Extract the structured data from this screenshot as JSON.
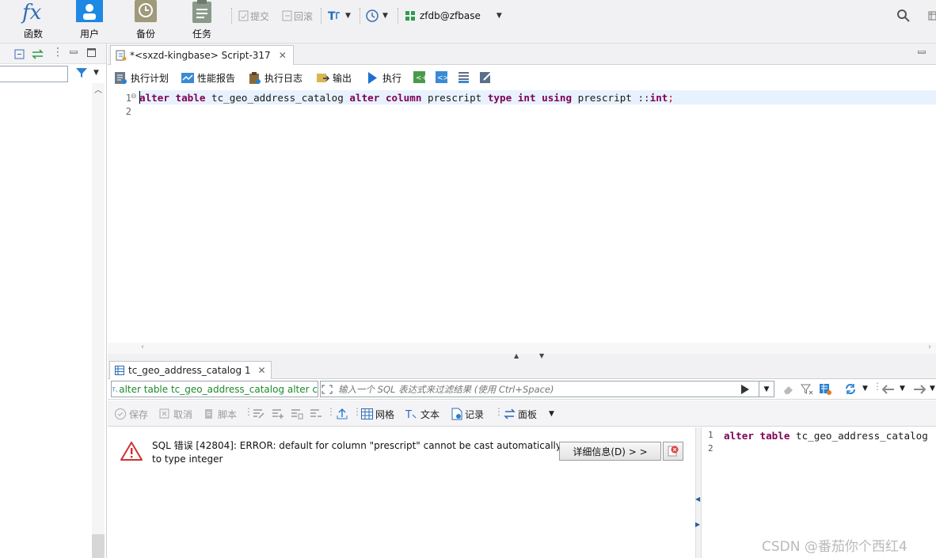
{
  "toolbar": {
    "functions_label": "函数",
    "users_label": "用户",
    "backup_label": "备份",
    "tasks_label": "任务",
    "commit_label": "提交",
    "rollback_label": "回滚",
    "connection_label": "zfdb@zfbase"
  },
  "editor": {
    "tab_title": "*<sxzd-kingbase> Script-317",
    "tools": {
      "exec_plan": "执行计划",
      "perf_report": "性能报告",
      "exec_log": "执行日志",
      "output": "输出",
      "execute": "执行"
    },
    "line_numbers": [
      "1",
      "2"
    ],
    "code": {
      "t1": "alter",
      "t2": " ",
      "t3": "table",
      "t4": " tc_geo_address_catalog ",
      "t5": "alter",
      "t6": " ",
      "t7": "column",
      "t8": " prescript ",
      "t9": "type",
      "t10": " ",
      "t11": "int",
      "t12": " ",
      "t13": "using",
      "t14": " prescript ::",
      "t15": "int",
      "t16": ";"
    }
  },
  "results": {
    "tab_title": "tc_geo_address_catalog 1",
    "query_preview": "alter table tc_geo_address_catalog alter c",
    "filter_placeholder": "输入一个 SQL 表达式来过滤结果 (使用 Ctrl+Space)",
    "tools": {
      "save": "保存",
      "cancel": "取消",
      "script": "脚本",
      "grid": "网格",
      "text": "文本",
      "record": "记录",
      "panel": "面板"
    },
    "error_line1": "SQL 错误 [42804]: ERROR: default for column \"prescript\" cannot be cast automatically",
    "error_line2": "to type integer",
    "details_button": "详细信息(D) > >",
    "sql_line_numbers": [
      "1",
      "2"
    ],
    "sql_preview": {
      "t1": "alter",
      "t2": " ",
      "t3": "table",
      "t4": " tc_geo_address_catalog"
    }
  },
  "watermark": "CSDN @番茄你个西红4",
  "colors": {
    "keyword": "#7f0055",
    "accent_blue": "#1f7ad8",
    "error_red": "#d32f2f"
  }
}
